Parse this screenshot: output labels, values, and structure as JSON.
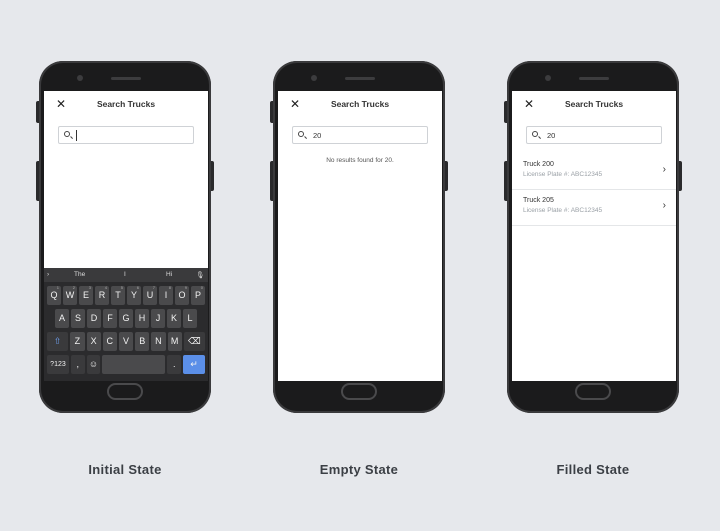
{
  "screen_title": "Search Trucks",
  "icons": {
    "close": "close-icon",
    "search": "search-icon",
    "chevron": "chevron-right-icon"
  },
  "phones": [
    {
      "caption": "Initial State",
      "search_value": "",
      "keyboard": {
        "suggestions": [
          "The",
          "I",
          "Hi"
        ],
        "row1": [
          "Q",
          "W",
          "E",
          "R",
          "T",
          "Y",
          "U",
          "I",
          "O",
          "P"
        ],
        "row1_numbers": [
          "1",
          "2",
          "3",
          "4",
          "5",
          "6",
          "7",
          "8",
          "9",
          "0"
        ],
        "row2": [
          "A",
          "S",
          "D",
          "F",
          "G",
          "H",
          "J",
          "K",
          "L"
        ],
        "row3": [
          "Z",
          "X",
          "C",
          "V",
          "B",
          "N",
          "M"
        ],
        "row4": {
          "symbols": "?123",
          "comma": ",",
          "period": "."
        }
      }
    },
    {
      "caption": "Empty State",
      "search_value": "20",
      "empty_message": "No results found for 20."
    },
    {
      "caption": "Filled State",
      "search_value": "20",
      "results": [
        {
          "title": "Truck 200",
          "plate": "License Plate #: ABC12345"
        },
        {
          "title": "Truck 205",
          "plate": "License Plate #: ABC12345"
        }
      ]
    }
  ]
}
